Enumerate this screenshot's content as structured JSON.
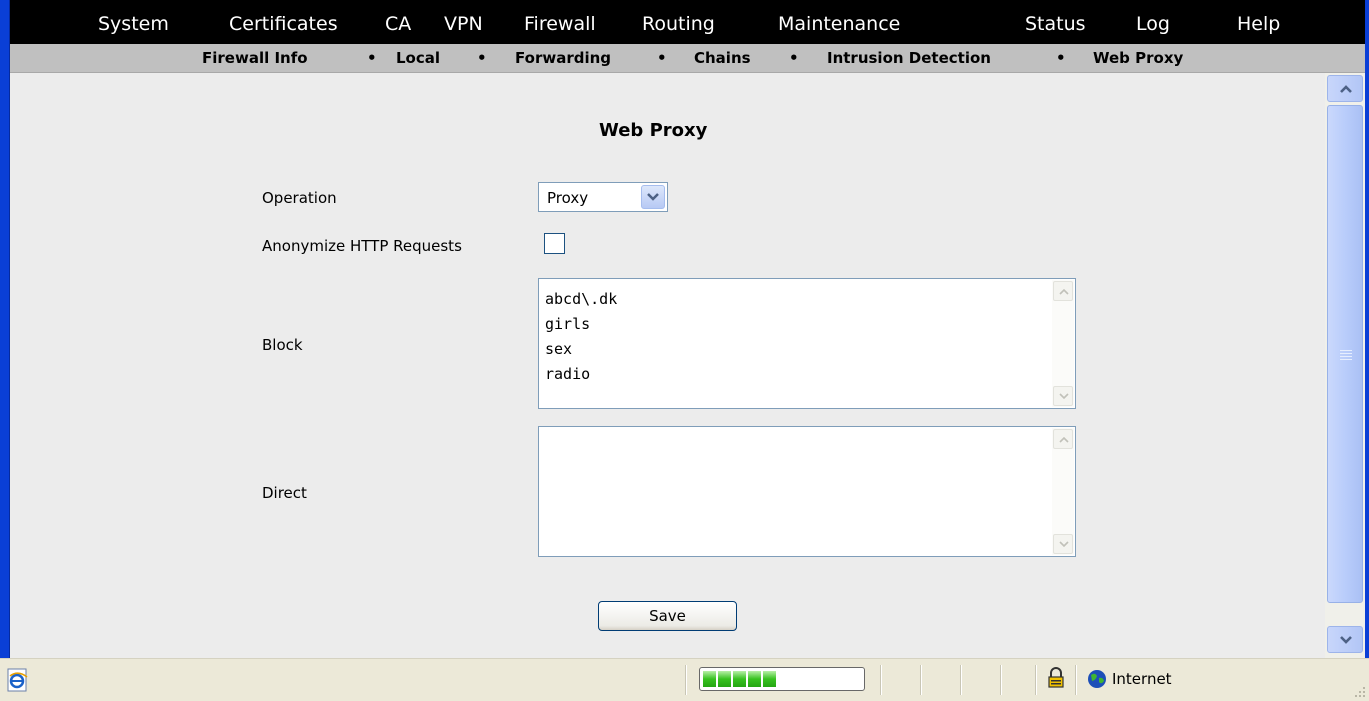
{
  "top_menu": [
    "System",
    "Certificates",
    "CA",
    "VPN",
    "Firewall",
    "Routing",
    "Maintenance",
    "Status",
    "Log",
    "Help"
  ],
  "sub_menu": {
    "items": [
      "Firewall Info",
      "Local",
      "Forwarding",
      "Chains",
      "Intrusion Detection",
      "Web Proxy"
    ],
    "separator": "•"
  },
  "page": {
    "title": "Web Proxy",
    "operation_label": "Operation",
    "operation_value": "Proxy",
    "anonymize_label": "Anonymize HTTP Requests",
    "anonymize_checked": false,
    "block_label": "Block",
    "block_value": "abcd\\.dk\ngirls\nsex\nradio",
    "direct_label": "Direct",
    "direct_value": "",
    "save_label": "Save"
  },
  "status_bar": {
    "zone": "Internet",
    "progress_blocks": 5
  },
  "icons": {
    "page": "ie-page-icon",
    "lock": "lock-icon",
    "zone": "globe-icon",
    "select": "chevron-down-icon"
  }
}
